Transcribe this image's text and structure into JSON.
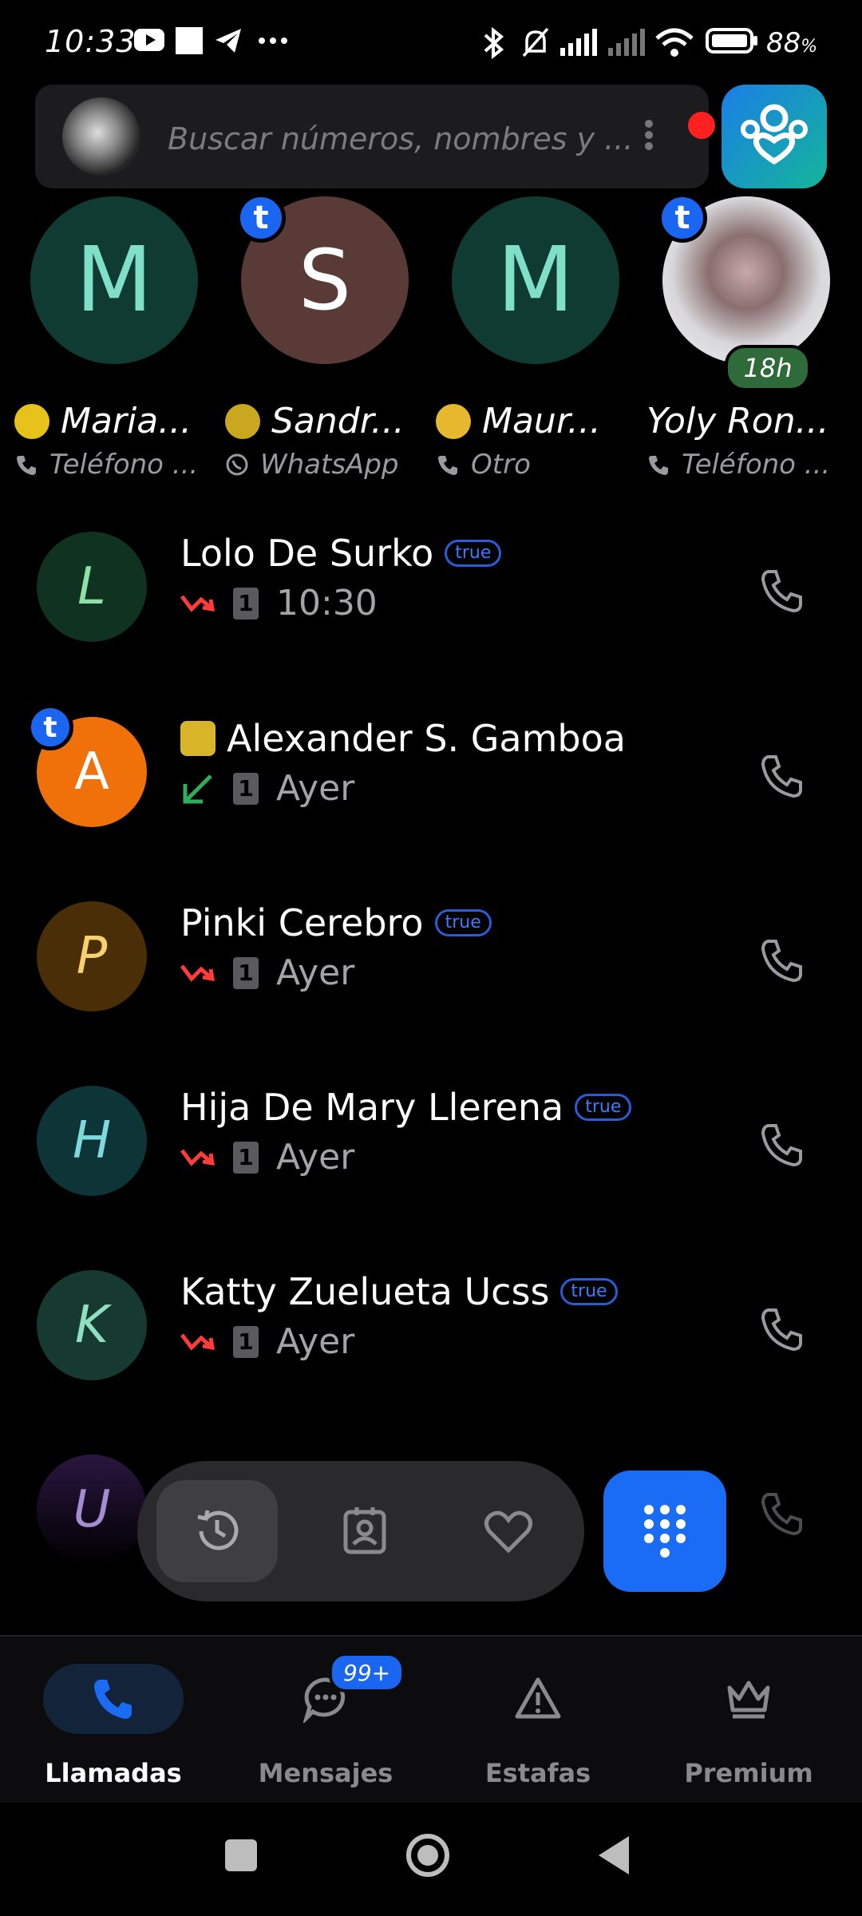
{
  "status_bar": {
    "time": "10:33",
    "battery": "88"
  },
  "search": {
    "placeholder": "Buscar números, nombres y ..."
  },
  "favorites": [
    {
      "initial": "M",
      "name": "Maria...",
      "type": "Teléfono ...",
      "type_icon": "phone-icon",
      "color": "#0f3b32",
      "fg": "#7fe0c7",
      "t_badge": false
    },
    {
      "initial": "S",
      "name": "Sandr...",
      "type": "WhatsApp",
      "type_icon": "whatsapp-icon",
      "color": "#5a3a36",
      "fg": "#ffffff",
      "t_badge": true
    },
    {
      "initial": "M",
      "name": "Maur...",
      "type": "Otro",
      "type_icon": "phone-icon",
      "color": "#0f3b32",
      "fg": "#7fe0c7",
      "t_badge": false
    },
    {
      "initial": "",
      "name": "Yoly Ron...",
      "type": "Teléfono ...",
      "type_icon": "phone-icon",
      "color": "#e8e8ea",
      "fg": "#000",
      "t_badge": true,
      "badge": "18h"
    }
  ],
  "calls": [
    {
      "initial": "L",
      "name": "Lolo De Surko",
      "badge": "true",
      "direction": "missed",
      "time": "10:30",
      "sim": "1",
      "color": "#0f3320",
      "fg": "#8fe0a8"
    },
    {
      "initial": "A",
      "name": "Alexander S. Gamboa",
      "badge": "",
      "direction": "incoming",
      "time": "Ayer",
      "sim": "1",
      "color": "#f0700a",
      "fg": "#ffffff",
      "t_badge": true,
      "emoji": true
    },
    {
      "initial": "P",
      "name": "Pinki Cerebro",
      "badge": "true",
      "direction": "missed",
      "time": "Ayer",
      "sim": "1",
      "color": "#4a2e08",
      "fg": "#f7d070"
    },
    {
      "initial": "H",
      "name": "Hija De Mary Llerena",
      "badge": "true",
      "direction": "missed",
      "time": "Ayer",
      "sim": "1",
      "color": "#0d3538",
      "fg": "#7fd9dc"
    },
    {
      "initial": "K",
      "name": "Katty Zuelueta Ucss",
      "badge": "true",
      "direction": "missed",
      "time": "Ayer",
      "sim": "1",
      "color": "#163a30",
      "fg": "#8fe0c0"
    },
    {
      "initial": "U",
      "name": "",
      "badge": "",
      "direction": "",
      "time": "",
      "sim": "",
      "color": "#2a1640",
      "fg": "#a58bd0"
    }
  ],
  "bottom_nav": [
    {
      "label": "Llamadas",
      "icon": "phone-icon",
      "active": true
    },
    {
      "label": "Mensajes",
      "icon": "chat-icon",
      "active": false
    },
    {
      "label": "Estafas",
      "icon": "warning-icon",
      "active": false
    },
    {
      "label": "Premium",
      "icon": "crown-icon",
      "active": false
    }
  ],
  "messages_badge": "99+",
  "colors": {
    "accent": "#1a6cf5",
    "missed": "#ff3b3b",
    "incoming": "#2fae5a"
  }
}
